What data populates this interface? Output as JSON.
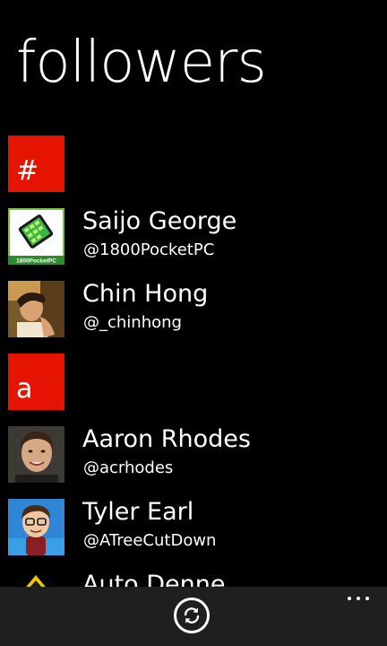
{
  "page": {
    "title": "followers"
  },
  "groups": [
    {
      "letter": "#",
      "people": [
        {
          "name": "Saijo George",
          "handle": "@1800PocketPC",
          "avatar_icon": "1800pocketpc-logo",
          "avatar_text": "1800PocketPC"
        },
        {
          "name": "Chin Hong",
          "handle": "@_chinhong",
          "avatar_icon": "profile-photo"
        }
      ]
    },
    {
      "letter": "a",
      "people": [
        {
          "name": "Aaron Rhodes",
          "handle": "@acrhodes",
          "avatar_icon": "profile-photo"
        },
        {
          "name": "Tyler Earl",
          "handle": "@ATreeCutDown",
          "avatar_icon": "cartoon-avatar"
        },
        {
          "name": "Auto Denne",
          "handle": "",
          "avatar_icon": "yellow-triangle-logo"
        }
      ]
    }
  ],
  "app_bar": {
    "refresh_icon": "refresh-icon",
    "more_icon": "more-ellipsis-icon"
  },
  "colors": {
    "accent": "#e51400",
    "background": "#000000",
    "app_bar": "#1f1f1f",
    "text": "#ffffff"
  }
}
